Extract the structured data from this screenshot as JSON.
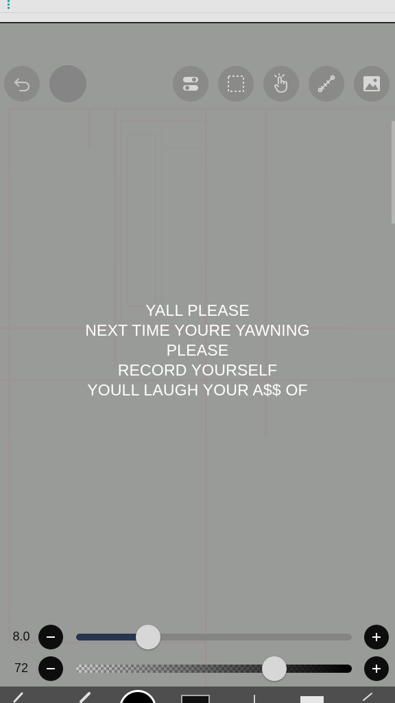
{
  "overlay_text": {
    "lines": [
      "YALL PLEASE",
      "NEXT TIME YOURE YAWNING",
      "PLEASE",
      "RECORD YOURSELF",
      "YOULL LAUGH YOUR A$$ OF"
    ]
  },
  "toolbar": {
    "left": [
      {
        "name": "undo",
        "icon": "undo-icon"
      },
      {
        "name": "color",
        "icon": "color-swatch"
      }
    ],
    "right": [
      {
        "name": "toggles",
        "icon": "toggle-icon"
      },
      {
        "name": "selection",
        "icon": "selection-icon"
      },
      {
        "name": "hand",
        "icon": "hand-icon"
      },
      {
        "name": "ruler",
        "icon": "ruler-icon"
      },
      {
        "name": "image",
        "icon": "image-icon"
      }
    ]
  },
  "brush_size": {
    "value": "8.0",
    "level": 0.26,
    "minus_icon": "minus-icon",
    "plus_icon": "plus-icon"
  },
  "opacity": {
    "value": "72",
    "level": 0.72,
    "minus_icon": "minus-icon",
    "plus_icon": "plus-icon"
  },
  "bottom_bar": {
    "items": [
      "brush-icon",
      "eraser-icon",
      "color-circle",
      "layer-swatch",
      "divider",
      "layers-icon",
      "check-icon"
    ]
  },
  "colors": {
    "canvas": "#999b98",
    "slider_fill": "#27354f",
    "status_accent": "#1aa9b5"
  }
}
